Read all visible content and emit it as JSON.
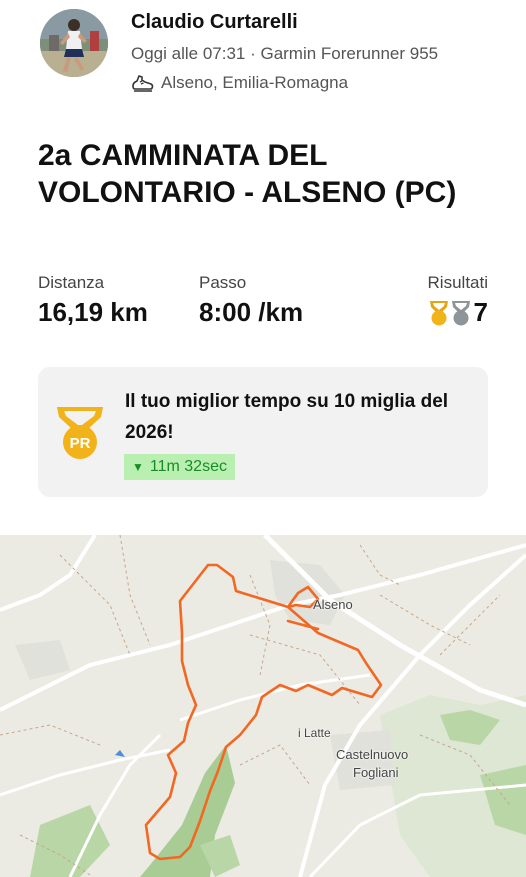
{
  "athlete": {
    "name": "Claudio Curtarelli",
    "meta": "Oggi alle 07:31 · Garmin Forerunner 955",
    "location": "Alseno, Emilia-Romagna",
    "avatar_icon": "avatar-photo",
    "activity_icon": "running-shoe-icon"
  },
  "activity": {
    "title": "2a CAMMINATA DEL VOLONTARIO - ALSENO (PC)"
  },
  "stats": {
    "distance_label": "Distanza",
    "distance_value": "16,19 km",
    "pace_label": "Passo",
    "pace_value": "8:00 /km",
    "results_label": "Risultati",
    "results_count": "7",
    "results_icons": [
      "gold-medal-icon",
      "silver-medal-icon"
    ]
  },
  "pr": {
    "badge_text": "PR",
    "text": "Il tuo miglior tempo su 10 miglia del 2026!",
    "delta": "11m 32sec",
    "delta_icon": "triangle-down-icon",
    "accent_color": "#F2B21A",
    "delta_bg": "#B9F0B2",
    "delta_color": "#1B8C25"
  },
  "map": {
    "labels": {
      "town_1": "Alseno",
      "place_1": "i Latte",
      "town_2_line1": "Castelnuovo",
      "town_2_line2": "Fogliani"
    },
    "route_color": "#F26722"
  }
}
